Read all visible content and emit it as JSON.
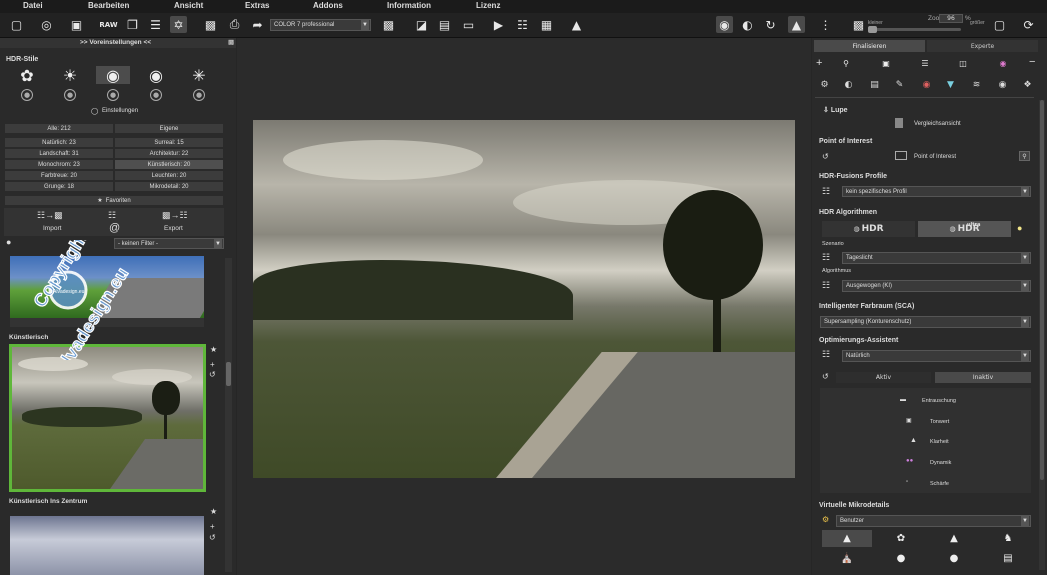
{
  "menu": [
    "Datei",
    "Bearbeiten",
    "Ansicht",
    "Extras",
    "Addons",
    "Information",
    "Lizenz"
  ],
  "toolbar": {
    "profile_select": "COLOR 7 professional",
    "zoom_smaller": "kleiner",
    "zoom_label": "Zoom",
    "zoom_value": "96",
    "zoom_unit": "%",
    "zoom_larger": "größer"
  },
  "left": {
    "presets_title": ">> Voreinstellungen <<",
    "styles_title": "HDR-Stile",
    "settings_label": "Einstellungen",
    "filter_all": "Alle: 212",
    "filter_own": "Eigene",
    "categories": [
      [
        "Natürlich: 23",
        "Surreal: 15"
      ],
      [
        "Landschaft: 31",
        "Architektur: 22"
      ],
      [
        "Monochrom: 23",
        "Künstlerisch: 20"
      ],
      [
        "Farbtreue: 20",
        "Leuchten: 20"
      ],
      [
        "Grunge: 18",
        "Mikrodetail: 20"
      ]
    ],
    "favorites": "Favoriten",
    "import": "Import",
    "export": "Export",
    "filter_select": "- keinen Filter -",
    "preset1_label": "Künstlerisch",
    "preset2_label": "Künstlerisch Ins Zentrum",
    "watermark_line1": "Copyright by",
    "watermark_line2": "Alvadesign.eu",
    "watermark_logo": "Alvadesign.eu"
  },
  "right": {
    "tab_finalize": "Finalisieren",
    "tab_expert": "Experte",
    "loupe_title": "Lupe",
    "compare_label": "Vergleichsansicht",
    "poi_title": "Point of Interest",
    "poi_label": "Point of Interest",
    "fusion_title": "HDR-Fusions Profile",
    "fusion_value": "kein spezifisches Profil",
    "algo_title": "HDR Algorithmen",
    "hdr_label": "HDR",
    "ultra_top": "ultra",
    "ultra_label": "HDR",
    "scenario_label": "Szenario",
    "scenario_value": "Tageslicht",
    "algorithm_label": "Algorithmus",
    "algorithm_value": "Ausgewogen (KI)",
    "sca_title": "Intelligenter Farbraum (SCA)",
    "sca_value": "Supersampling (Konturenschutz)",
    "opt_title": "Optimierungs-Assistent",
    "opt_value": "Natürlich",
    "active": "Aktiv",
    "inactive": "Inaktiv",
    "assistant_items": [
      "Entrauschung",
      "Tonwert",
      "Klarheit",
      "Dynamik",
      "Schärfe"
    ],
    "micro_title": "Virtuelle Mikrodetails",
    "micro_value": "Benutzer"
  },
  "colors": {
    "accent_green": "#5fb73a",
    "panel": "#2a2a2a",
    "background": "#262626"
  }
}
